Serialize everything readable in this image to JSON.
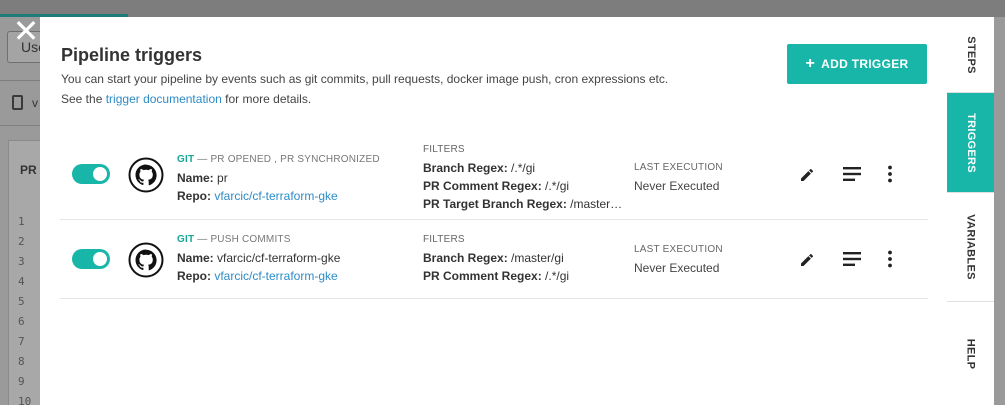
{
  "background": {
    "select_label": "Use",
    "file_label": "v",
    "editor_label": "PR",
    "line_numbers": [
      "1",
      "2",
      "3",
      "4",
      "5",
      "6",
      "7",
      "8",
      "9",
      "10"
    ]
  },
  "modal": {
    "title": "Pipeline triggers",
    "description_line1": "You can start your pipeline by events such as git commits, pull requests, docker image push, cron expressions etc.",
    "description_prefix": "See the",
    "description_link": "trigger documentation",
    "description_suffix": "for more details.",
    "add_button_label": "ADD TRIGGER",
    "close_glyph": "✕"
  },
  "labels": {
    "git": "GIT",
    "dash": "—",
    "name": "Name:",
    "repo": "Repo:",
    "filters": "FILTERS",
    "last_execution": "LAST EXECUTION"
  },
  "triggers": [
    {
      "enabled": true,
      "events": "PR OPENED , PR SYNCHRONIZED",
      "name": "pr",
      "repo": "vfarcic/cf-terraform-gke",
      "filters": [
        {
          "label": "Branch Regex:",
          "value": "/.*/gi"
        },
        {
          "label": "PR Comment Regex:",
          "value": "/.*/gi"
        },
        {
          "label": "PR Target Branch Regex:",
          "value": "/master…"
        }
      ],
      "last_execution": "Never Executed"
    },
    {
      "enabled": true,
      "events": "PUSH COMMITS",
      "name": "vfarcic/cf-terraform-gke",
      "repo": "vfarcic/cf-terraform-gke",
      "filters": [
        {
          "label": "Branch Regex:",
          "value": "/master/gi"
        },
        {
          "label": "PR Comment Regex:",
          "value": "/.*/gi"
        }
      ],
      "last_execution": "Never Executed"
    }
  ],
  "side_tabs": [
    {
      "label": "STEPS",
      "active": false
    },
    {
      "label": "TRIGGERS",
      "active": true
    },
    {
      "label": "VARIABLES",
      "active": false
    },
    {
      "label": "HELP",
      "active": false
    }
  ],
  "icons": {
    "close": "close-icon",
    "add": "plus-icon",
    "provider": "github-icon",
    "edit": "pencil-icon",
    "builds": "list-icon",
    "more": "more-vertical-icon"
  },
  "colors": {
    "accent": "#17b6a8",
    "link": "#2e8bc5",
    "git_label": "#17a597"
  }
}
